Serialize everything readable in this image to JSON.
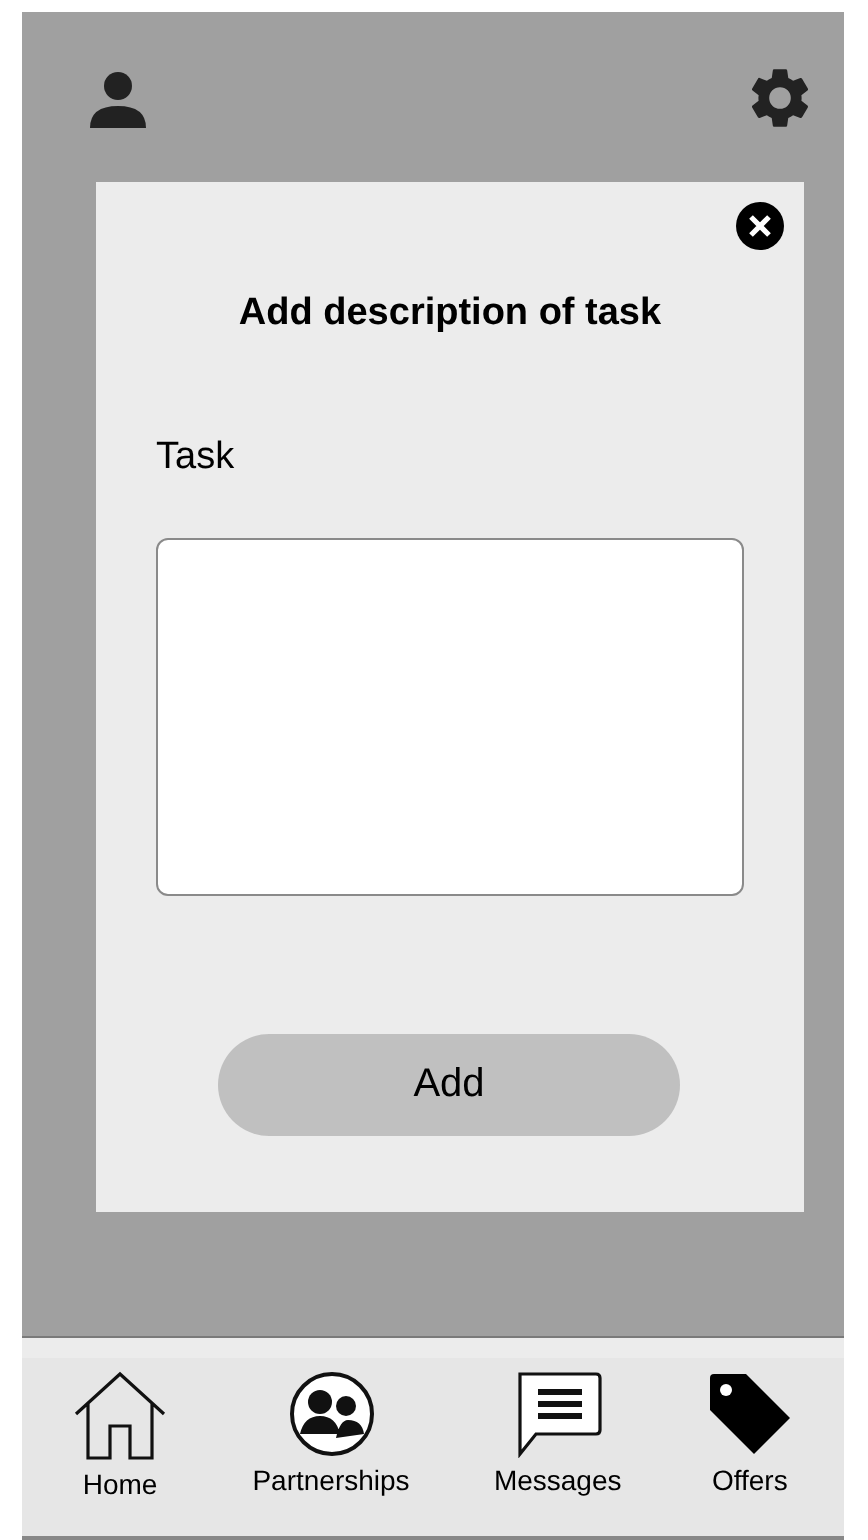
{
  "dialog": {
    "title": "Add description of task",
    "field_label": "Task",
    "button": "Add"
  },
  "nav": [
    {
      "label": "Home"
    },
    {
      "label": "Partnerships"
    },
    {
      "label": "Messages"
    },
    {
      "label": "Offers"
    }
  ]
}
